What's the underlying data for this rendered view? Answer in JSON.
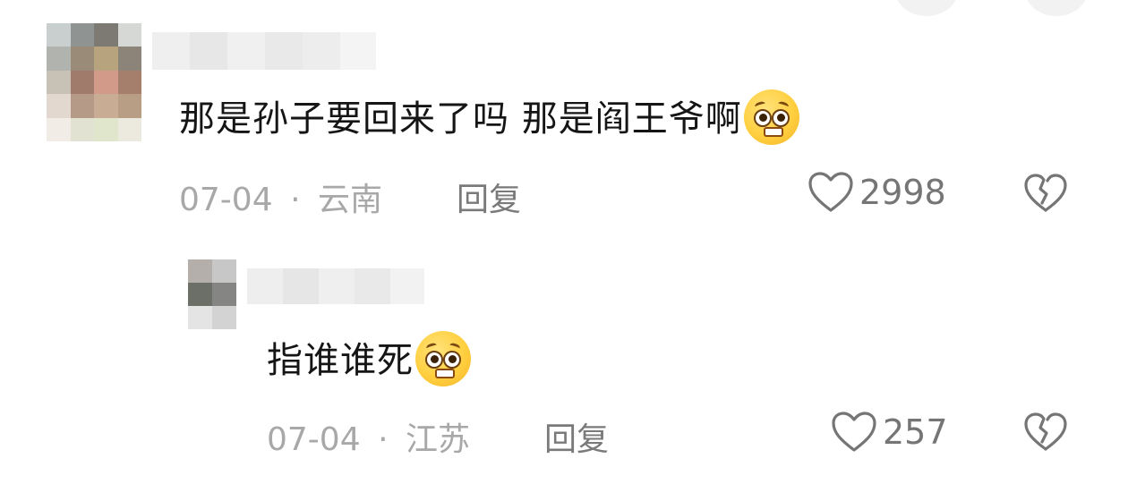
{
  "comments": [
    {
      "text": "那是孙子要回来了吗  那是阎王爷啊",
      "emoji": "pleading-face-emoji",
      "date": "07-04",
      "separator": "·",
      "location": "云南",
      "reply_label": "回复",
      "like_count": "2998"
    },
    {
      "text": "指谁谁死",
      "emoji": "pleading-face-emoji",
      "date": "07-04",
      "separator": "·",
      "location": "江苏",
      "reply_label": "回复",
      "like_count": "257"
    }
  ],
  "colors": {
    "text": "#151515",
    "meta": "#a8a8a8",
    "reply": "#7a7a7a",
    "icon": "#757575"
  }
}
